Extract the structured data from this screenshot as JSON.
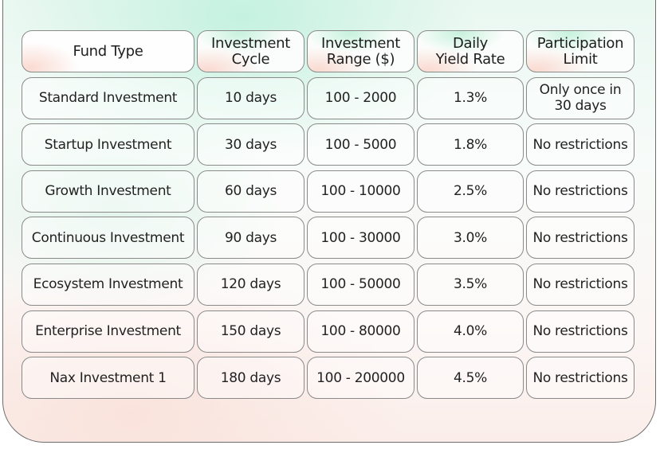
{
  "table": {
    "headers": [
      "Fund Type",
      "Investment\nCycle",
      "Investment\nRange ($)",
      "Daily\nYield Rate",
      "Participation\nLimit"
    ],
    "header_lines": [
      [
        "Fund Type"
      ],
      [
        "Investment",
        "Cycle"
      ],
      [
        "Investment",
        "Range ($)"
      ],
      [
        "Daily",
        "Yield Rate"
      ],
      [
        "Participation",
        "Limit"
      ]
    ],
    "rows": [
      {
        "fund_type": "Standard Investment",
        "cycle": "10 days",
        "range": "100 - 2000",
        "daily_yield": "1.3%",
        "limit_lines": [
          "Only once in",
          "30 days"
        ]
      },
      {
        "fund_type": "Startup Investment",
        "cycle": "30 days",
        "range": "100 - 5000",
        "daily_yield": "1.8%",
        "limit_lines": [
          "No restrictions"
        ]
      },
      {
        "fund_type": "Growth Investment",
        "cycle": "60 days",
        "range": "100 - 10000",
        "daily_yield": "2.5%",
        "limit_lines": [
          "No restrictions"
        ]
      },
      {
        "fund_type": "Continuous Investment",
        "cycle": "90 days",
        "range": "100 - 30000",
        "daily_yield": "3.0%",
        "limit_lines": [
          "No restrictions"
        ]
      },
      {
        "fund_type": "Ecosystem Investment",
        "cycle": "120 days",
        "range": "100 - 50000",
        "daily_yield": "3.5%",
        "limit_lines": [
          "No restrictions"
        ]
      },
      {
        "fund_type": "Enterprise Investment",
        "cycle": "150 days",
        "range": "100 - 80000",
        "daily_yield": "4.0%",
        "limit_lines": [
          "No restrictions"
        ]
      },
      {
        "fund_type": "Nax Investment 1",
        "cycle": "180 days",
        "range": "100 - 200000",
        "daily_yield": "4.5%",
        "limit_lines": [
          "No restrictions"
        ]
      }
    ]
  },
  "colors": {
    "border": "#8a8a8a",
    "text": "#222222",
    "mint_accent": "#bef0d7",
    "peach_accent": "#fad7cd"
  }
}
